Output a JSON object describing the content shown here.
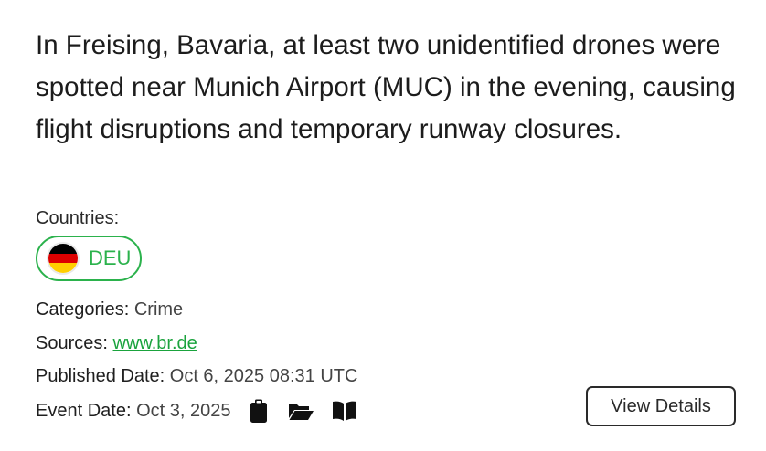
{
  "event": {
    "headline": "In Freising, Bavaria, at least two unidentified drones were spotted near Munich Airport (MUC) in the evening, causing flight disruptions and temporary runway closures.",
    "countries_label": "Countries:",
    "countries": [
      {
        "code": "DEU",
        "flag_icon": "germany-flag-icon"
      }
    ],
    "categories_label": "Categories:",
    "categories_value": "Crime",
    "sources_label": "Sources:",
    "sources_value": "www.br.de",
    "published_label": "Published Date:",
    "published_value": "Oct 6, 2025 08:31 UTC",
    "event_date_label": "Event Date:",
    "event_date_value": "Oct 3, 2025",
    "action_icons": [
      "clipboard-icon",
      "folder-open-icon",
      "book-open-icon"
    ],
    "view_details_label": "View Details"
  },
  "colors": {
    "accent": "#2bb24c",
    "link": "#1aa33d",
    "text": "#222222"
  }
}
